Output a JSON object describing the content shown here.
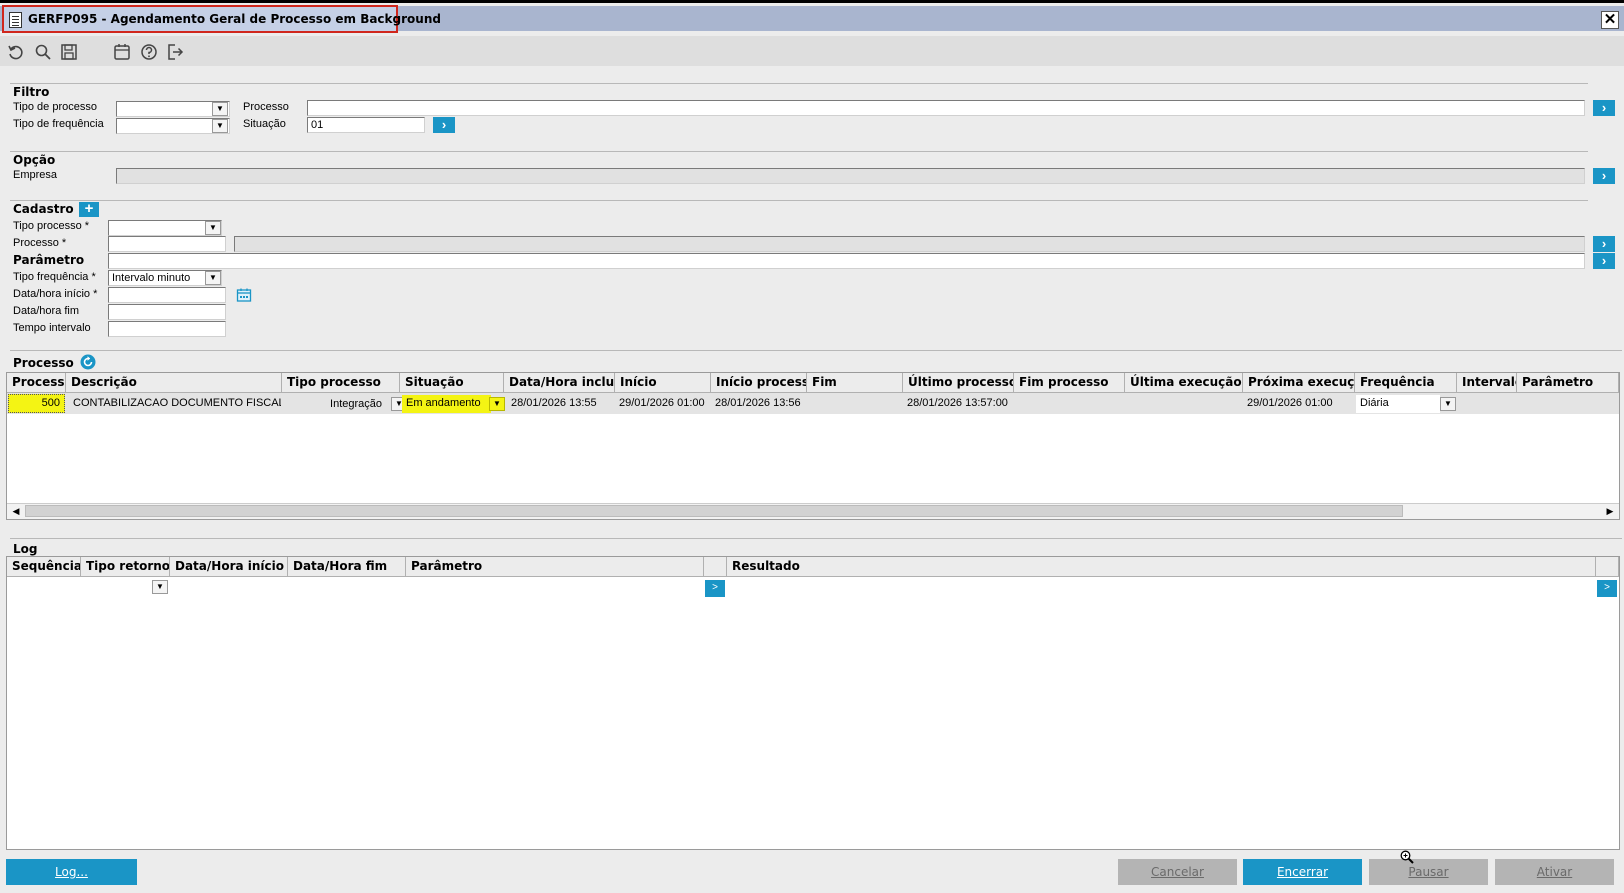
{
  "window": {
    "title": "GERFP095 - Agendamento Geral de Processo em Background",
    "close": "✕"
  },
  "toolbar": {
    "icons": [
      "undo-icon",
      "search-icon",
      "save-icon",
      "calendar-icon",
      "help-icon",
      "exit-icon"
    ]
  },
  "filtro": {
    "title": "Filtro",
    "tipo_processo_label": "Tipo de processo",
    "processo_label": "Processo",
    "tipo_frequencia_label": "Tipo de frequência",
    "situacao_label": "Situação",
    "situacao_value": "01"
  },
  "opcao": {
    "title": "Opção",
    "empresa_label": "Empresa"
  },
  "cadastro": {
    "title": "Cadastro",
    "tipo_processo_label": "Tipo processo *",
    "processo_label": "Processo *",
    "parametro_label": "Parâmetro",
    "tipo_frequencia_label": "Tipo frequência *",
    "tipo_frequencia_value": "Intervalo minuto",
    "data_inicio_label": "Data/hora início *",
    "data_fim_label": "Data/hora fim",
    "tempo_intervalo_label": "Tempo intervalo"
  },
  "processo_grid": {
    "title": "Processo",
    "columns": [
      "Processo",
      "Descrição",
      "Tipo processo",
      "Situação",
      "Data/Hora inclusão",
      "Início",
      "Início processo",
      "Fim",
      "Último processo",
      "Fim processo",
      "Última execução",
      "Próxima execução",
      "Frequência",
      "Intervalo",
      "Parâmetro"
    ],
    "row": {
      "processo": "500",
      "descricao": "CONTABILIZACAO DOCUMENTO FISCAL",
      "tipo_processo": "Integração",
      "situacao": "Em andamento",
      "data_inclusao": "28/01/2026 13:55",
      "inicio": "29/01/2026 01:00",
      "inicio_processo": "28/01/2026 13:56",
      "ultimo_processo": "28/01/2026 13:57:00",
      "proxima_execucao": "29/01/2026 01:00",
      "frequencia": "Diária"
    },
    "highlight_color": "#f4f414"
  },
  "log_grid": {
    "title": "Log",
    "columns": [
      "Sequência",
      "Tipo retorno",
      "Data/Hora início",
      "Data/Hora fim",
      "Parâmetro",
      "Resultado"
    ]
  },
  "buttons": {
    "log": "Log...",
    "cancelar": "Cancelar",
    "encerrar": "Encerrar",
    "pausar": "Pausar",
    "ativar": "Ativar"
  },
  "colors": {
    "accent": "#1a95c6",
    "title_bar": "#a9b5cf",
    "title_highlight_border": "#d0261c"
  }
}
